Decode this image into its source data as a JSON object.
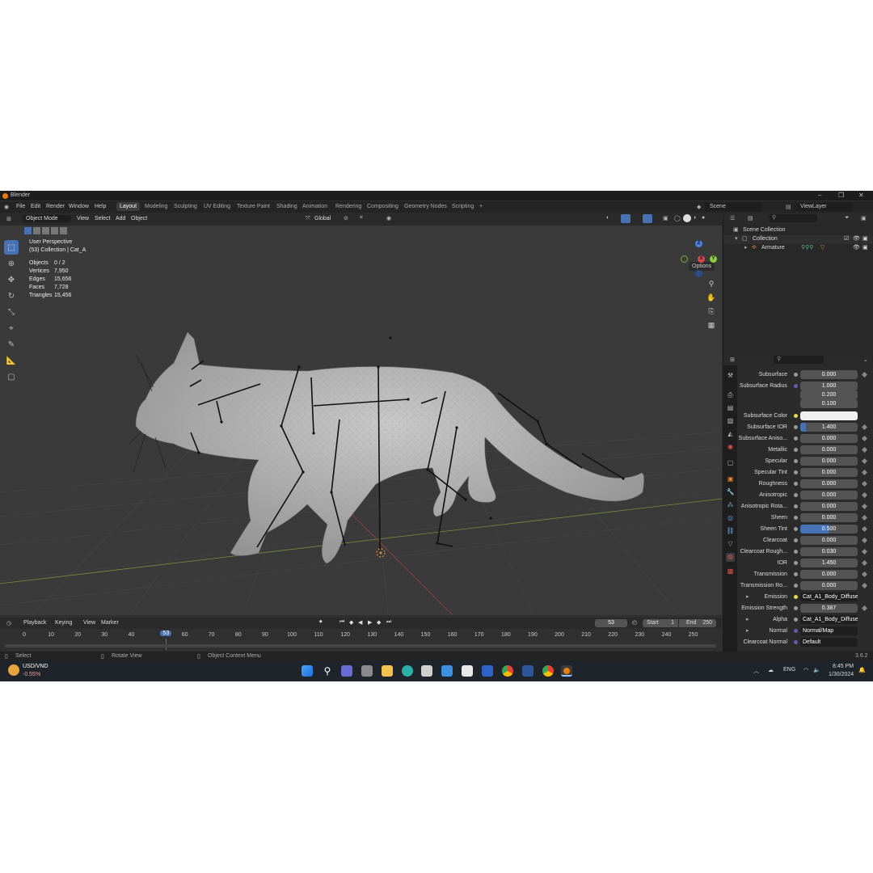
{
  "app": {
    "title": "Blender"
  },
  "menus": [
    "File",
    "Edit",
    "Render",
    "Window",
    "Help"
  ],
  "workspaces": [
    "Layout",
    "Modeling",
    "Sculpting",
    "UV Editing",
    "Texture Paint",
    "Shading",
    "Animation",
    "Rendering",
    "Compositing",
    "Geometry Nodes",
    "Scripting"
  ],
  "active_workspace": "Layout",
  "scene": {
    "name": "Scene",
    "view_layer": "ViewLayer"
  },
  "viewport_header": {
    "mode": "Object Mode",
    "menus": [
      "View",
      "Select",
      "Add",
      "Object"
    ],
    "orientation": "Global",
    "options": "Options"
  },
  "viewport": {
    "view_name": "User Perspective",
    "collection_line": "(53) Collection | Cat_A",
    "stats": [
      {
        "label": "Objects",
        "value": "0 / 2"
      },
      {
        "label": "Vertices",
        "value": "7,950"
      },
      {
        "label": "Edges",
        "value": "15,656"
      },
      {
        "label": "Faces",
        "value": "7,728"
      },
      {
        "label": "Triangles",
        "value": "15,456"
      }
    ]
  },
  "gizmo": {
    "x": "X",
    "y": "Y",
    "z": "Z"
  },
  "outliner": {
    "root": "Scene Collection",
    "collection": "Collection",
    "object": "Armature"
  },
  "properties": [
    {
      "label": "Subsurface",
      "value": "0.000"
    },
    {
      "label": "Subsurface Radius",
      "value": "1.000"
    },
    {
      "label": "",
      "value": "0.200"
    },
    {
      "label": "",
      "value": "0.100"
    },
    {
      "label": "Subsurface Color",
      "value": ""
    },
    {
      "label": "Subsurface IOR",
      "value": "1.400"
    },
    {
      "label": "Subsurface Aniso...",
      "value": "0.000"
    },
    {
      "label": "Metallic",
      "value": "0.000"
    },
    {
      "label": "Specular",
      "value": "0.000"
    },
    {
      "label": "Specular Tint",
      "value": "0.000"
    },
    {
      "label": "Roughness",
      "value": "0.000"
    },
    {
      "label": "Anisotropic",
      "value": "0.000"
    },
    {
      "label": "Anisotropic Rota...",
      "value": "0.000"
    },
    {
      "label": "Sheen",
      "value": "0.000"
    },
    {
      "label": "Sheen Tint",
      "value": "0.500"
    },
    {
      "label": "Clearcoat",
      "value": "0.000"
    },
    {
      "label": "Clearcoat Rough...",
      "value": "0.030"
    },
    {
      "label": "IOR",
      "value": "1.450"
    },
    {
      "label": "Transmission",
      "value": "0.000"
    },
    {
      "label": "Transmission Ro...",
      "value": "0.000"
    },
    {
      "label": "Emission",
      "value": "Cat_A1_Body_Diffuse"
    },
    {
      "label": "Emission Strength",
      "value": "0.387"
    },
    {
      "label": "Alpha",
      "value": "Cat_A1_Body_Diffuse..."
    },
    {
      "label": "Normal",
      "value": "Normal/Map"
    },
    {
      "label": "Clearcoat Normal",
      "value": "Default"
    }
  ],
  "timeline": {
    "menus": [
      "Playback",
      "Keying",
      "View",
      "Marker"
    ],
    "current_frame": "53",
    "start_label": "Start",
    "start": "1",
    "end_label": "End",
    "end": "250",
    "ticks": [
      "0",
      "10",
      "20",
      "30",
      "40",
      "50",
      "60",
      "70",
      "80",
      "90",
      "100",
      "110",
      "120",
      "130",
      "140",
      "150",
      "160",
      "170",
      "180",
      "190",
      "200",
      "210",
      "220",
      "230",
      "240",
      "250"
    ]
  },
  "statusbar": {
    "select": "Select",
    "rotate": "Rotate View",
    "context": "Object Context Menu",
    "version": "3.6.2"
  },
  "taskbar": {
    "ticker": "USD/VND",
    "change": "-0.55%",
    "lang": "ENG",
    "time": "8:45 PM",
    "date": "1/30/2024"
  }
}
